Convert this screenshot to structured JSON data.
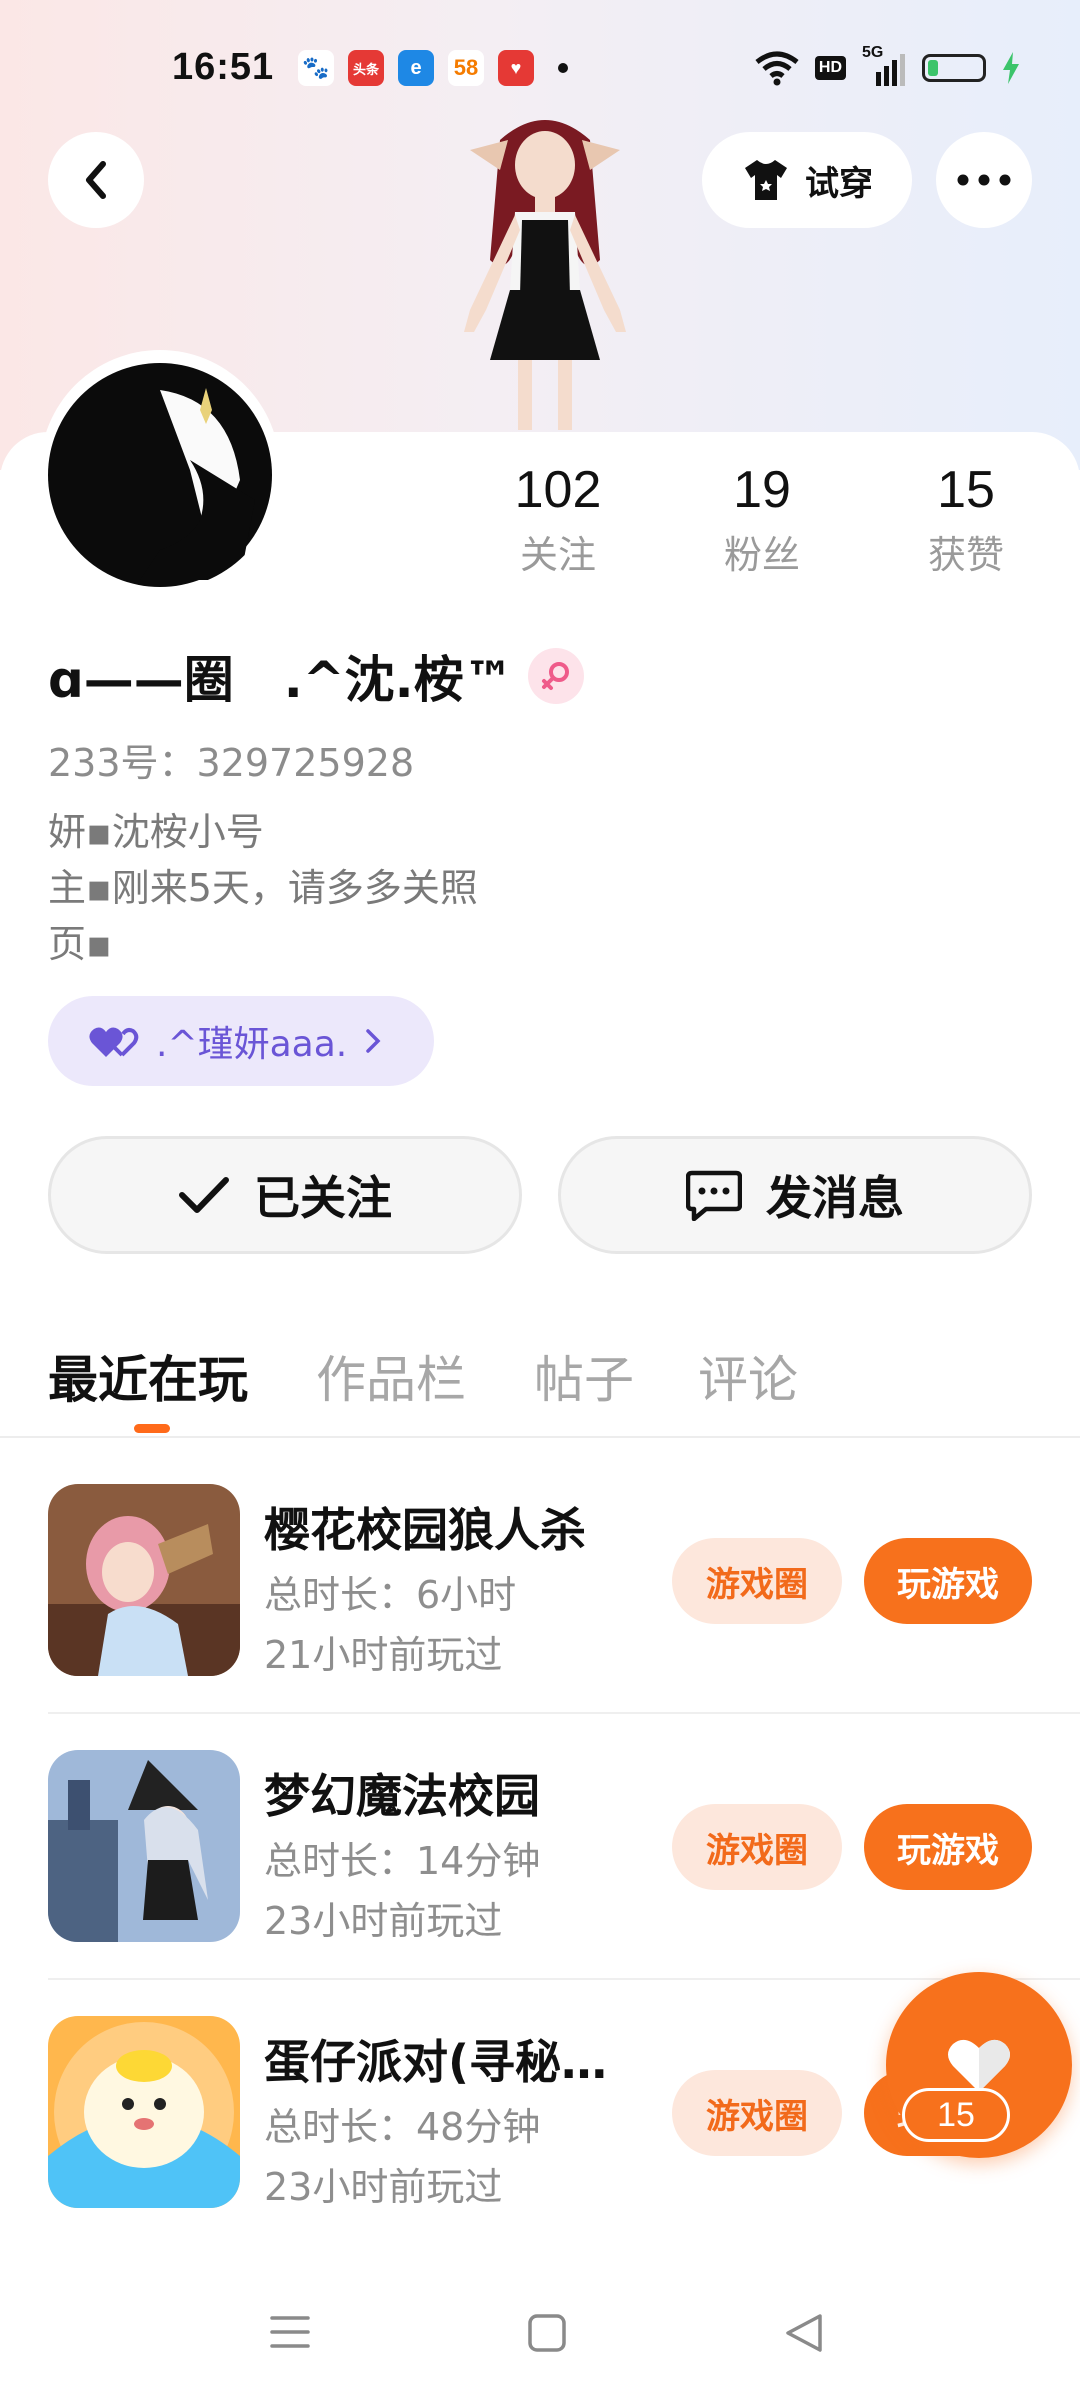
{
  "status_bar": {
    "time": "16:51",
    "apps": [
      {
        "name": "baidu-icon",
        "label": "",
        "color": "#2f5bea"
      },
      {
        "name": "toutiao-icon",
        "label": "头条",
        "color": "#e53935"
      },
      {
        "name": "browser-icon",
        "label": "",
        "color": "#1e88e5"
      },
      {
        "name": "58-icon",
        "label": "58",
        "color": "#f57c00"
      },
      {
        "name": "app-icon",
        "label": "",
        "color": "#e53935"
      }
    ],
    "network": "5G",
    "hd": "HD",
    "battery_level": 0.2
  },
  "header": {
    "try_on_label": "试穿"
  },
  "stats": [
    {
      "value": "102",
      "label": "关注"
    },
    {
      "value": "19",
      "label": "粉丝"
    },
    {
      "value": "15",
      "label": "获赞"
    }
  ],
  "profile": {
    "username": "ɑ——圈　.^沈.桉™",
    "uid": "233号：329725928",
    "bio_lines": [
      "妍▪沈桉小号",
      "主▪刚来5天，请多多关照",
      "页▪"
    ],
    "relation_label": ".^瑾妍aaa."
  },
  "actions": {
    "followed_label": "已关注",
    "message_label": "发消息"
  },
  "tabs": [
    "最近在玩",
    "作品栏",
    "帖子",
    "评论"
  ],
  "games": [
    {
      "title": "樱花校园狼人杀",
      "duration": "总时长：6小时",
      "last_played": "21小时前玩过",
      "circle_label": "游戏圈",
      "play_label": "玩游戏"
    },
    {
      "title": "梦幻魔法校园",
      "duration": "总时长：14分钟",
      "last_played": "23小时前玩过",
      "circle_label": "游戏圈",
      "play_label": "玩游戏"
    },
    {
      "title": "蛋仔派对(寻秘…",
      "duration": "总时长：48分钟",
      "last_played": "23小时前玩过",
      "circle_label": "游戏圈",
      "play_label": "玩游戏"
    }
  ],
  "like_fab": {
    "count": "15"
  },
  "colors": {
    "accent": "#f7711c",
    "accent_light": "#fde7dc",
    "relation_bg": "#ece8fb",
    "relation_text": "#6a55d6"
  }
}
